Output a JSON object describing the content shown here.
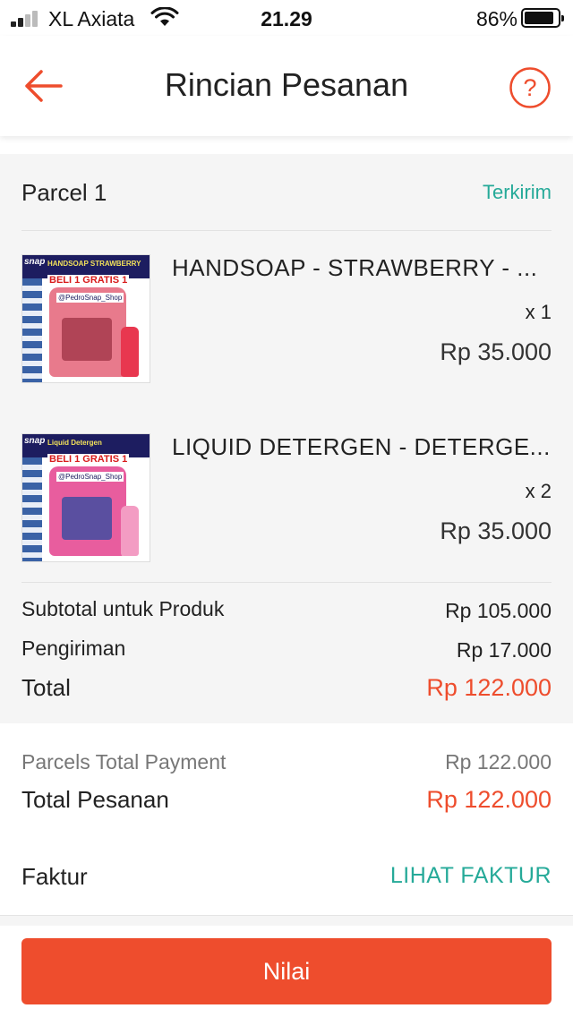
{
  "status_bar": {
    "carrier": "XL Axiata",
    "time": "21.29",
    "battery": "86%"
  },
  "nav": {
    "title": "Rincian Pesanan",
    "back_icon": "arrow-left-icon",
    "help_icon": "question-circle-icon"
  },
  "parcel": {
    "title": "Parcel 1",
    "status": "Terkirim",
    "items": [
      {
        "name": "HANDSOAP - STRAWBERRY - ...",
        "qty": "x 1",
        "price": "Rp 35.000",
        "thumb": {
          "brand": "snap",
          "product": "HANDSOAP STRAWBERRY",
          "promo": "BELI 1 GRATIS 1",
          "shop": "@PedroSnap_Shop",
          "color": "#e87a8c",
          "bottle_color": "#e8374f"
        }
      },
      {
        "name": "LIQUID DETERGEN - DETERGE...",
        "qty": "x 2",
        "price": "Rp 35.000",
        "thumb": {
          "brand": "snap",
          "product": "Liquid Detergen",
          "promo": "BELI 1 GRATIS 1",
          "shop": "@PedroSnap_Shop",
          "color": "#e85d9e",
          "bottle_color": "#f39cc3"
        }
      }
    ],
    "summary": {
      "subtotal_label": "Subtotal untuk Produk",
      "subtotal_value": "Rp 105.000",
      "shipping_label": "Pengiriman",
      "shipping_value": "Rp 17.000",
      "total_label": "Total",
      "total_value": "Rp 122.000"
    }
  },
  "payment": {
    "parcels_total_label": "Parcels Total Payment",
    "parcels_total_value": "Rp 122.000",
    "order_total_label": "Total Pesanan",
    "order_total_value": "Rp 122.000",
    "invoice_label": "Faktur",
    "invoice_link": "LIHAT FAKTUR"
  },
  "action": {
    "rate_label": "Nilai"
  },
  "colors": {
    "accent": "#ee4d2d",
    "status_green": "#26aa99"
  }
}
